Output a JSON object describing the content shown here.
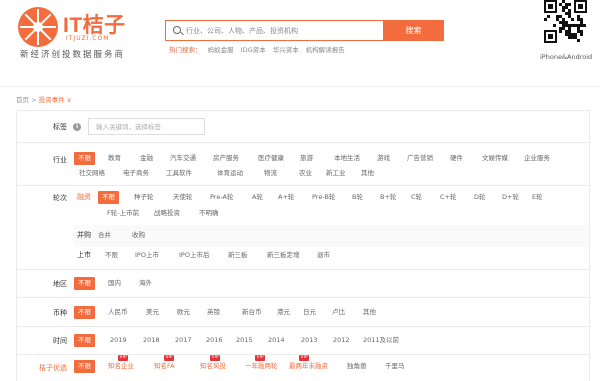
{
  "brand": {
    "title": "IT桔子",
    "domain": "ITJUZI.COM",
    "slogan": "新经济创投数据服务商",
    "accent": "#f36c3d"
  },
  "search": {
    "placeholder": "行业、公司、人物、产品、投资机构",
    "button": "搜索",
    "hot_label": "热门搜索：",
    "hot_links": [
      "蚂蚁金服",
      "IDG资本",
      "华兴资本",
      "机构解读报告"
    ]
  },
  "qr": {
    "caption": "iPhone&Android"
  },
  "breadcrumb": {
    "home": "首页",
    "sep": ">",
    "current": "投资事件",
    "caret": "∨"
  },
  "filters": {
    "tag": {
      "label": "标签",
      "info": "i",
      "placeholder": "输入关键词，选择标签"
    },
    "industry": {
      "label": "行业",
      "options": [
        "不限",
        "教育",
        "金融",
        "汽车交通",
        "房产服务",
        "医疗健康",
        "旅游",
        "本地生活",
        "游戏",
        "广告营销",
        "硬件",
        "文娱传媒",
        "企业服务",
        "社交网络",
        "电子商务",
        "工具软件",
        "体育运动",
        "物流",
        "农业",
        "新工业",
        "其他"
      ]
    },
    "round": {
      "label": "轮次",
      "financing_label": "融资",
      "financing_options": [
        "不限",
        "种子轮",
        "天使轮",
        "Pre-A轮",
        "A轮",
        "A+轮",
        "Pre-B轮",
        "B轮",
        "B+轮",
        "C轮",
        "C+轮",
        "D轮",
        "D+轮",
        "E轮",
        "F轮-上市前",
        "战略投资",
        "不明确"
      ],
      "merger_label": "并购",
      "merger_options": [
        "合并",
        "收购"
      ],
      "ipo_label": "上市",
      "ipo_options": [
        "不限",
        "IPO上市",
        "IPO上市后",
        "新三板",
        "新三板定增",
        "退市"
      ]
    },
    "region": {
      "label": "地区",
      "options": [
        "不限",
        "国内",
        "海外"
      ]
    },
    "currency": {
      "label": "币种",
      "options": [
        "不限",
        "人民币",
        "美元",
        "欧元",
        "英镑",
        "新台币",
        "港元",
        "日元",
        "卢比",
        "其他"
      ]
    },
    "time": {
      "label": "时间",
      "options": [
        "不限",
        "2019",
        "2018",
        "2017",
        "2016",
        "2015",
        "2014",
        "2013",
        "2012",
        "2011及以前"
      ]
    },
    "juzi": {
      "label": "桔子优选",
      "options": [
        "不限",
        "知名企业",
        "知名FA",
        "知名风投",
        "一年融两轮",
        "最两年未融资",
        "独角兽",
        "千里马"
      ],
      "vip_badge": "VIP"
    }
  }
}
